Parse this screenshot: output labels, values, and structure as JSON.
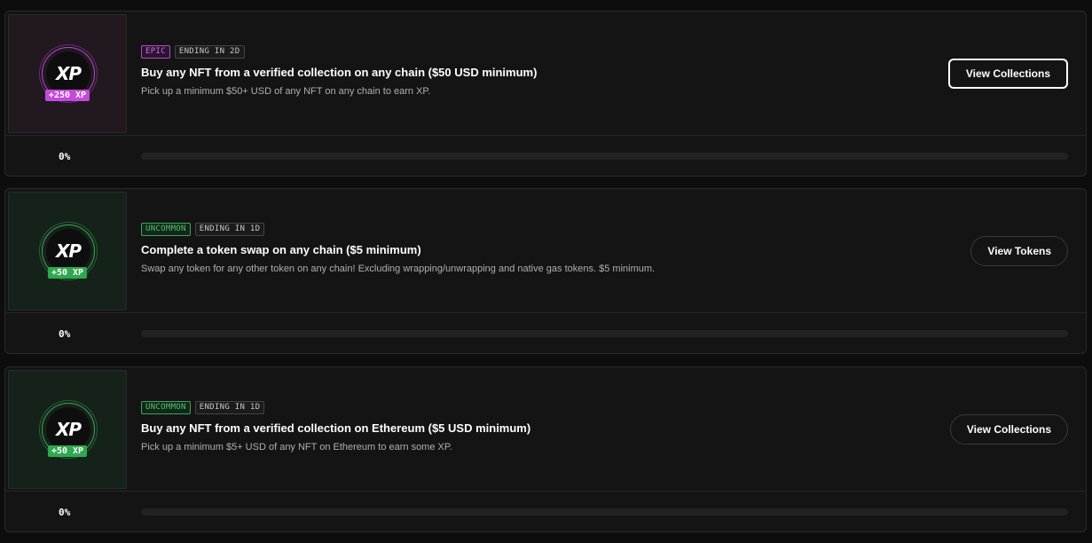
{
  "quests": [
    {
      "rarity": "EPIC",
      "rarity_class": "epic",
      "ending": "ENDING IN 2D",
      "reward": "+250 XP",
      "logo_text": "XP",
      "title": "Buy any NFT from a verified collection on any chain ($50 USD minimum)",
      "description": "Pick up a minimum $50+ USD of any NFT on any chain to earn XP.",
      "button_label": "View Collections",
      "progress_label": "0%",
      "progress": 0
    },
    {
      "rarity": "UNCOMMON",
      "rarity_class": "uncommon",
      "ending": "ENDING IN 1D",
      "reward": "+50 XP",
      "logo_text": "XP",
      "title": "Complete a token swap on any chain ($5 minimum)",
      "description": "Swap any token for any other token on any chain! Excluding wrapping/unwrapping and native gas tokens. $5 minimum.",
      "button_label": "View Tokens",
      "progress_label": "0%",
      "progress": 0
    },
    {
      "rarity": "UNCOMMON",
      "rarity_class": "uncommon",
      "ending": "ENDING IN 1D",
      "reward": "+50 XP",
      "logo_text": "XP",
      "title": "Buy any NFT from a verified collection on Ethereum ($5 USD minimum)",
      "description": "Pick up a minimum $5+ USD of any NFT on Ethereum to earn some XP.",
      "button_label": "View Collections",
      "progress_label": "0%",
      "progress": 0
    }
  ],
  "colors": {
    "epic": "#c54ad9",
    "uncommon": "#2fa84f",
    "background": "#0d0d0d",
    "card": "#141414"
  }
}
